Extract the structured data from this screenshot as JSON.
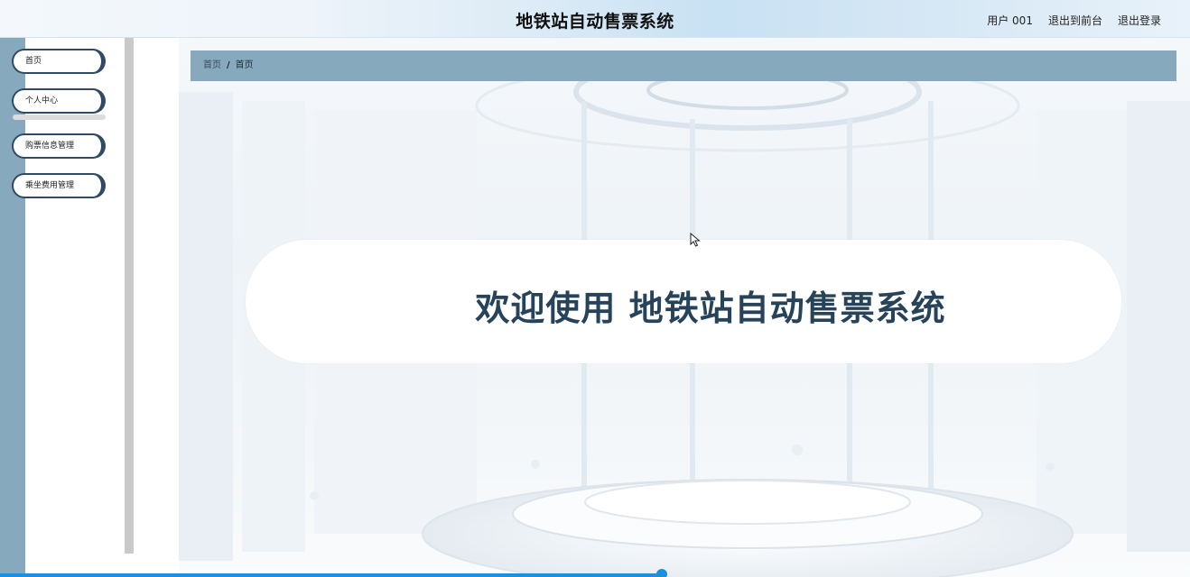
{
  "header": {
    "title": "地铁站自动售票系统",
    "user_label": "用户 001",
    "back_label": "退出到前台",
    "logout_label": "退出登录"
  },
  "sidebar": {
    "items": [
      {
        "label": "首页"
      },
      {
        "label": "个人中心"
      },
      {
        "label": "购票信息管理"
      },
      {
        "label": "乘坐费用管理"
      }
    ]
  },
  "breadcrumb": {
    "items": [
      "首页",
      "首页"
    ],
    "separator": "/"
  },
  "welcome": {
    "text": "欢迎使用 地铁站自动售票系统"
  },
  "colors": {
    "accent": "#86a9bd",
    "title_dark": "#26435a",
    "progress": "#1b8fe0"
  },
  "icons": {
    "cursor": "mouse-cursor-icon"
  }
}
